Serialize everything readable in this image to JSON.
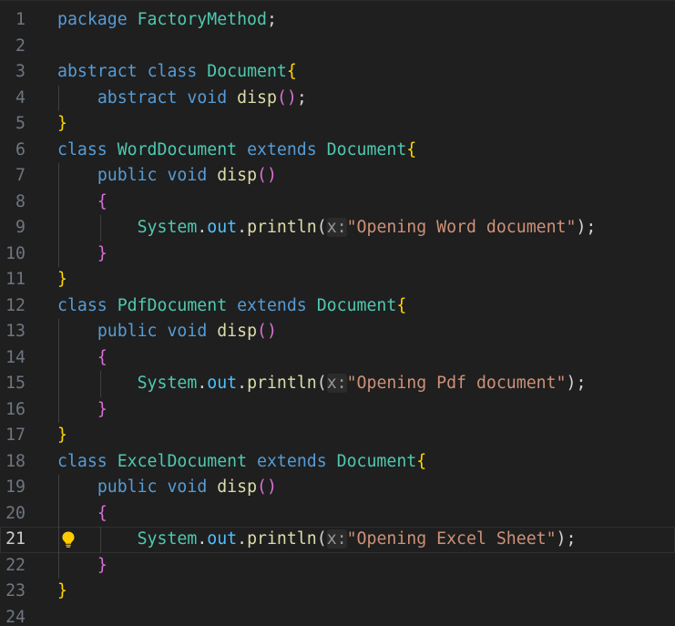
{
  "editor": {
    "lines": [
      {
        "n": "1",
        "tokens": [
          {
            "t": "package",
            "c": "kw"
          },
          {
            "t": " ",
            "c": "pun"
          },
          {
            "t": "FactoryMethod",
            "c": "ty"
          },
          {
            "t": ";",
            "c": "pun"
          }
        ]
      },
      {
        "n": "2",
        "tokens": []
      },
      {
        "n": "3",
        "tokens": [
          {
            "t": "abstract",
            "c": "kw"
          },
          {
            "t": " ",
            "c": "pun"
          },
          {
            "t": "class",
            "c": "kw"
          },
          {
            "t": " ",
            "c": "pun"
          },
          {
            "t": "Document",
            "c": "ty"
          },
          {
            "t": "{",
            "c": "b1"
          }
        ]
      },
      {
        "n": "4",
        "guides": 1,
        "tokens": [
          {
            "t": "    ",
            "c": "pun"
          },
          {
            "t": "abstract",
            "c": "kw"
          },
          {
            "t": " ",
            "c": "pun"
          },
          {
            "t": "void",
            "c": "kw"
          },
          {
            "t": " ",
            "c": "pun"
          },
          {
            "t": "disp",
            "c": "fn"
          },
          {
            "t": "()",
            "c": "b2"
          },
          {
            "t": ";",
            "c": "pun"
          }
        ]
      },
      {
        "n": "5",
        "tokens": [
          {
            "t": "}",
            "c": "b1"
          }
        ]
      },
      {
        "n": "6",
        "tokens": [
          {
            "t": "class",
            "c": "kw"
          },
          {
            "t": " ",
            "c": "pun"
          },
          {
            "t": "WordDocument",
            "c": "ty"
          },
          {
            "t": " ",
            "c": "pun"
          },
          {
            "t": "extends",
            "c": "kw"
          },
          {
            "t": " ",
            "c": "pun"
          },
          {
            "t": "Document",
            "c": "ty"
          },
          {
            "t": "{",
            "c": "b1"
          }
        ]
      },
      {
        "n": "7",
        "guides": 1,
        "tokens": [
          {
            "t": "    ",
            "c": "pun"
          },
          {
            "t": "public",
            "c": "kw"
          },
          {
            "t": " ",
            "c": "pun"
          },
          {
            "t": "void",
            "c": "kw"
          },
          {
            "t": " ",
            "c": "pun"
          },
          {
            "t": "disp",
            "c": "fn"
          },
          {
            "t": "()",
            "c": "b2"
          }
        ]
      },
      {
        "n": "8",
        "guides": 1,
        "tokens": [
          {
            "t": "    ",
            "c": "pun"
          },
          {
            "t": "{",
            "c": "b2"
          }
        ]
      },
      {
        "n": "9",
        "guides": 2,
        "tokens": [
          {
            "t": "        ",
            "c": "pun"
          },
          {
            "t": "System",
            "c": "ty"
          },
          {
            "t": ".",
            "c": "pun"
          },
          {
            "t": "out",
            "c": "prop"
          },
          {
            "t": ".",
            "c": "pun"
          },
          {
            "t": "println",
            "c": "fn"
          },
          {
            "t": "(",
            "c": "pun"
          },
          {
            "t": "x:",
            "c": "hint"
          },
          {
            "t": "\"Opening Word document\"",
            "c": "str"
          },
          {
            "t": ");",
            "c": "pun"
          }
        ]
      },
      {
        "n": "10",
        "guides": 1,
        "tokens": [
          {
            "t": "    ",
            "c": "pun"
          },
          {
            "t": "}",
            "c": "b2"
          }
        ]
      },
      {
        "n": "11",
        "tokens": [
          {
            "t": "}",
            "c": "b1"
          }
        ]
      },
      {
        "n": "12",
        "tokens": [
          {
            "t": "class",
            "c": "kw"
          },
          {
            "t": " ",
            "c": "pun"
          },
          {
            "t": "PdfDocument",
            "c": "ty"
          },
          {
            "t": " ",
            "c": "pun"
          },
          {
            "t": "extends",
            "c": "kw"
          },
          {
            "t": " ",
            "c": "pun"
          },
          {
            "t": "Document",
            "c": "ty"
          },
          {
            "t": "{",
            "c": "b1"
          }
        ]
      },
      {
        "n": "13",
        "guides": 1,
        "tokens": [
          {
            "t": "    ",
            "c": "pun"
          },
          {
            "t": "public",
            "c": "kw"
          },
          {
            "t": " ",
            "c": "pun"
          },
          {
            "t": "void",
            "c": "kw"
          },
          {
            "t": " ",
            "c": "pun"
          },
          {
            "t": "disp",
            "c": "fn"
          },
          {
            "t": "()",
            "c": "b2"
          }
        ]
      },
      {
        "n": "14",
        "guides": 1,
        "tokens": [
          {
            "t": "    ",
            "c": "pun"
          },
          {
            "t": "{",
            "c": "b2"
          }
        ]
      },
      {
        "n": "15",
        "guides": 2,
        "tokens": [
          {
            "t": "        ",
            "c": "pun"
          },
          {
            "t": "System",
            "c": "ty"
          },
          {
            "t": ".",
            "c": "pun"
          },
          {
            "t": "out",
            "c": "prop"
          },
          {
            "t": ".",
            "c": "pun"
          },
          {
            "t": "println",
            "c": "fn"
          },
          {
            "t": "(",
            "c": "pun"
          },
          {
            "t": "x:",
            "c": "hint"
          },
          {
            "t": "\"Opening Pdf document\"",
            "c": "str"
          },
          {
            "t": ");",
            "c": "pun"
          }
        ]
      },
      {
        "n": "16",
        "guides": 1,
        "tokens": [
          {
            "t": "    ",
            "c": "pun"
          },
          {
            "t": "}",
            "c": "b2"
          }
        ]
      },
      {
        "n": "17",
        "tokens": [
          {
            "t": "}",
            "c": "b1"
          }
        ]
      },
      {
        "n": "18",
        "tokens": [
          {
            "t": "class",
            "c": "kw"
          },
          {
            "t": " ",
            "c": "pun"
          },
          {
            "t": "ExcelDocument",
            "c": "ty"
          },
          {
            "t": " ",
            "c": "pun"
          },
          {
            "t": "extends",
            "c": "kw"
          },
          {
            "t": " ",
            "c": "pun"
          },
          {
            "t": "Document",
            "c": "ty"
          },
          {
            "t": "{",
            "c": "b1"
          }
        ]
      },
      {
        "n": "19",
        "guides": 1,
        "tokens": [
          {
            "t": "    ",
            "c": "pun"
          },
          {
            "t": "public",
            "c": "kw"
          },
          {
            "t": " ",
            "c": "pun"
          },
          {
            "t": "void",
            "c": "kw"
          },
          {
            "t": " ",
            "c": "pun"
          },
          {
            "t": "disp",
            "c": "fn"
          },
          {
            "t": "()",
            "c": "b2"
          }
        ]
      },
      {
        "n": "20",
        "guides": 1,
        "tokens": [
          {
            "t": "    ",
            "c": "pun"
          },
          {
            "t": "{",
            "c": "b2"
          }
        ]
      },
      {
        "n": "21",
        "guides": 2,
        "current": true,
        "bulb": true,
        "tokens": [
          {
            "t": "        ",
            "c": "pun"
          },
          {
            "t": "System",
            "c": "ty"
          },
          {
            "t": ".",
            "c": "pun"
          },
          {
            "t": "out",
            "c": "prop"
          },
          {
            "t": ".",
            "c": "pun"
          },
          {
            "t": "println",
            "c": "fn"
          },
          {
            "t": "(",
            "c": "pun"
          },
          {
            "t": "x:",
            "c": "hint"
          },
          {
            "t": "\"Opening Excel Sheet\"",
            "c": "str"
          },
          {
            "t": ");",
            "c": "pun"
          }
        ]
      },
      {
        "n": "22",
        "guides": 1,
        "tokens": [
          {
            "t": "    ",
            "c": "pun"
          },
          {
            "t": "}",
            "c": "b2"
          }
        ]
      },
      {
        "n": "23",
        "tokens": [
          {
            "t": "}",
            "c": "b1"
          }
        ]
      },
      {
        "n": "24",
        "tokens": []
      }
    ]
  },
  "colors": {
    "background": "#1f1f1f",
    "keyword": "#569cd6",
    "type": "#4ec9b0",
    "function": "#dcdcaa",
    "property": "#4fc1ff",
    "string": "#ce9178",
    "bracket_level1": "#ffd700",
    "bracket_level2": "#da70d6",
    "line_number": "#6e7681"
  },
  "icons": {
    "quick_fix": "lightbulb-icon"
  }
}
